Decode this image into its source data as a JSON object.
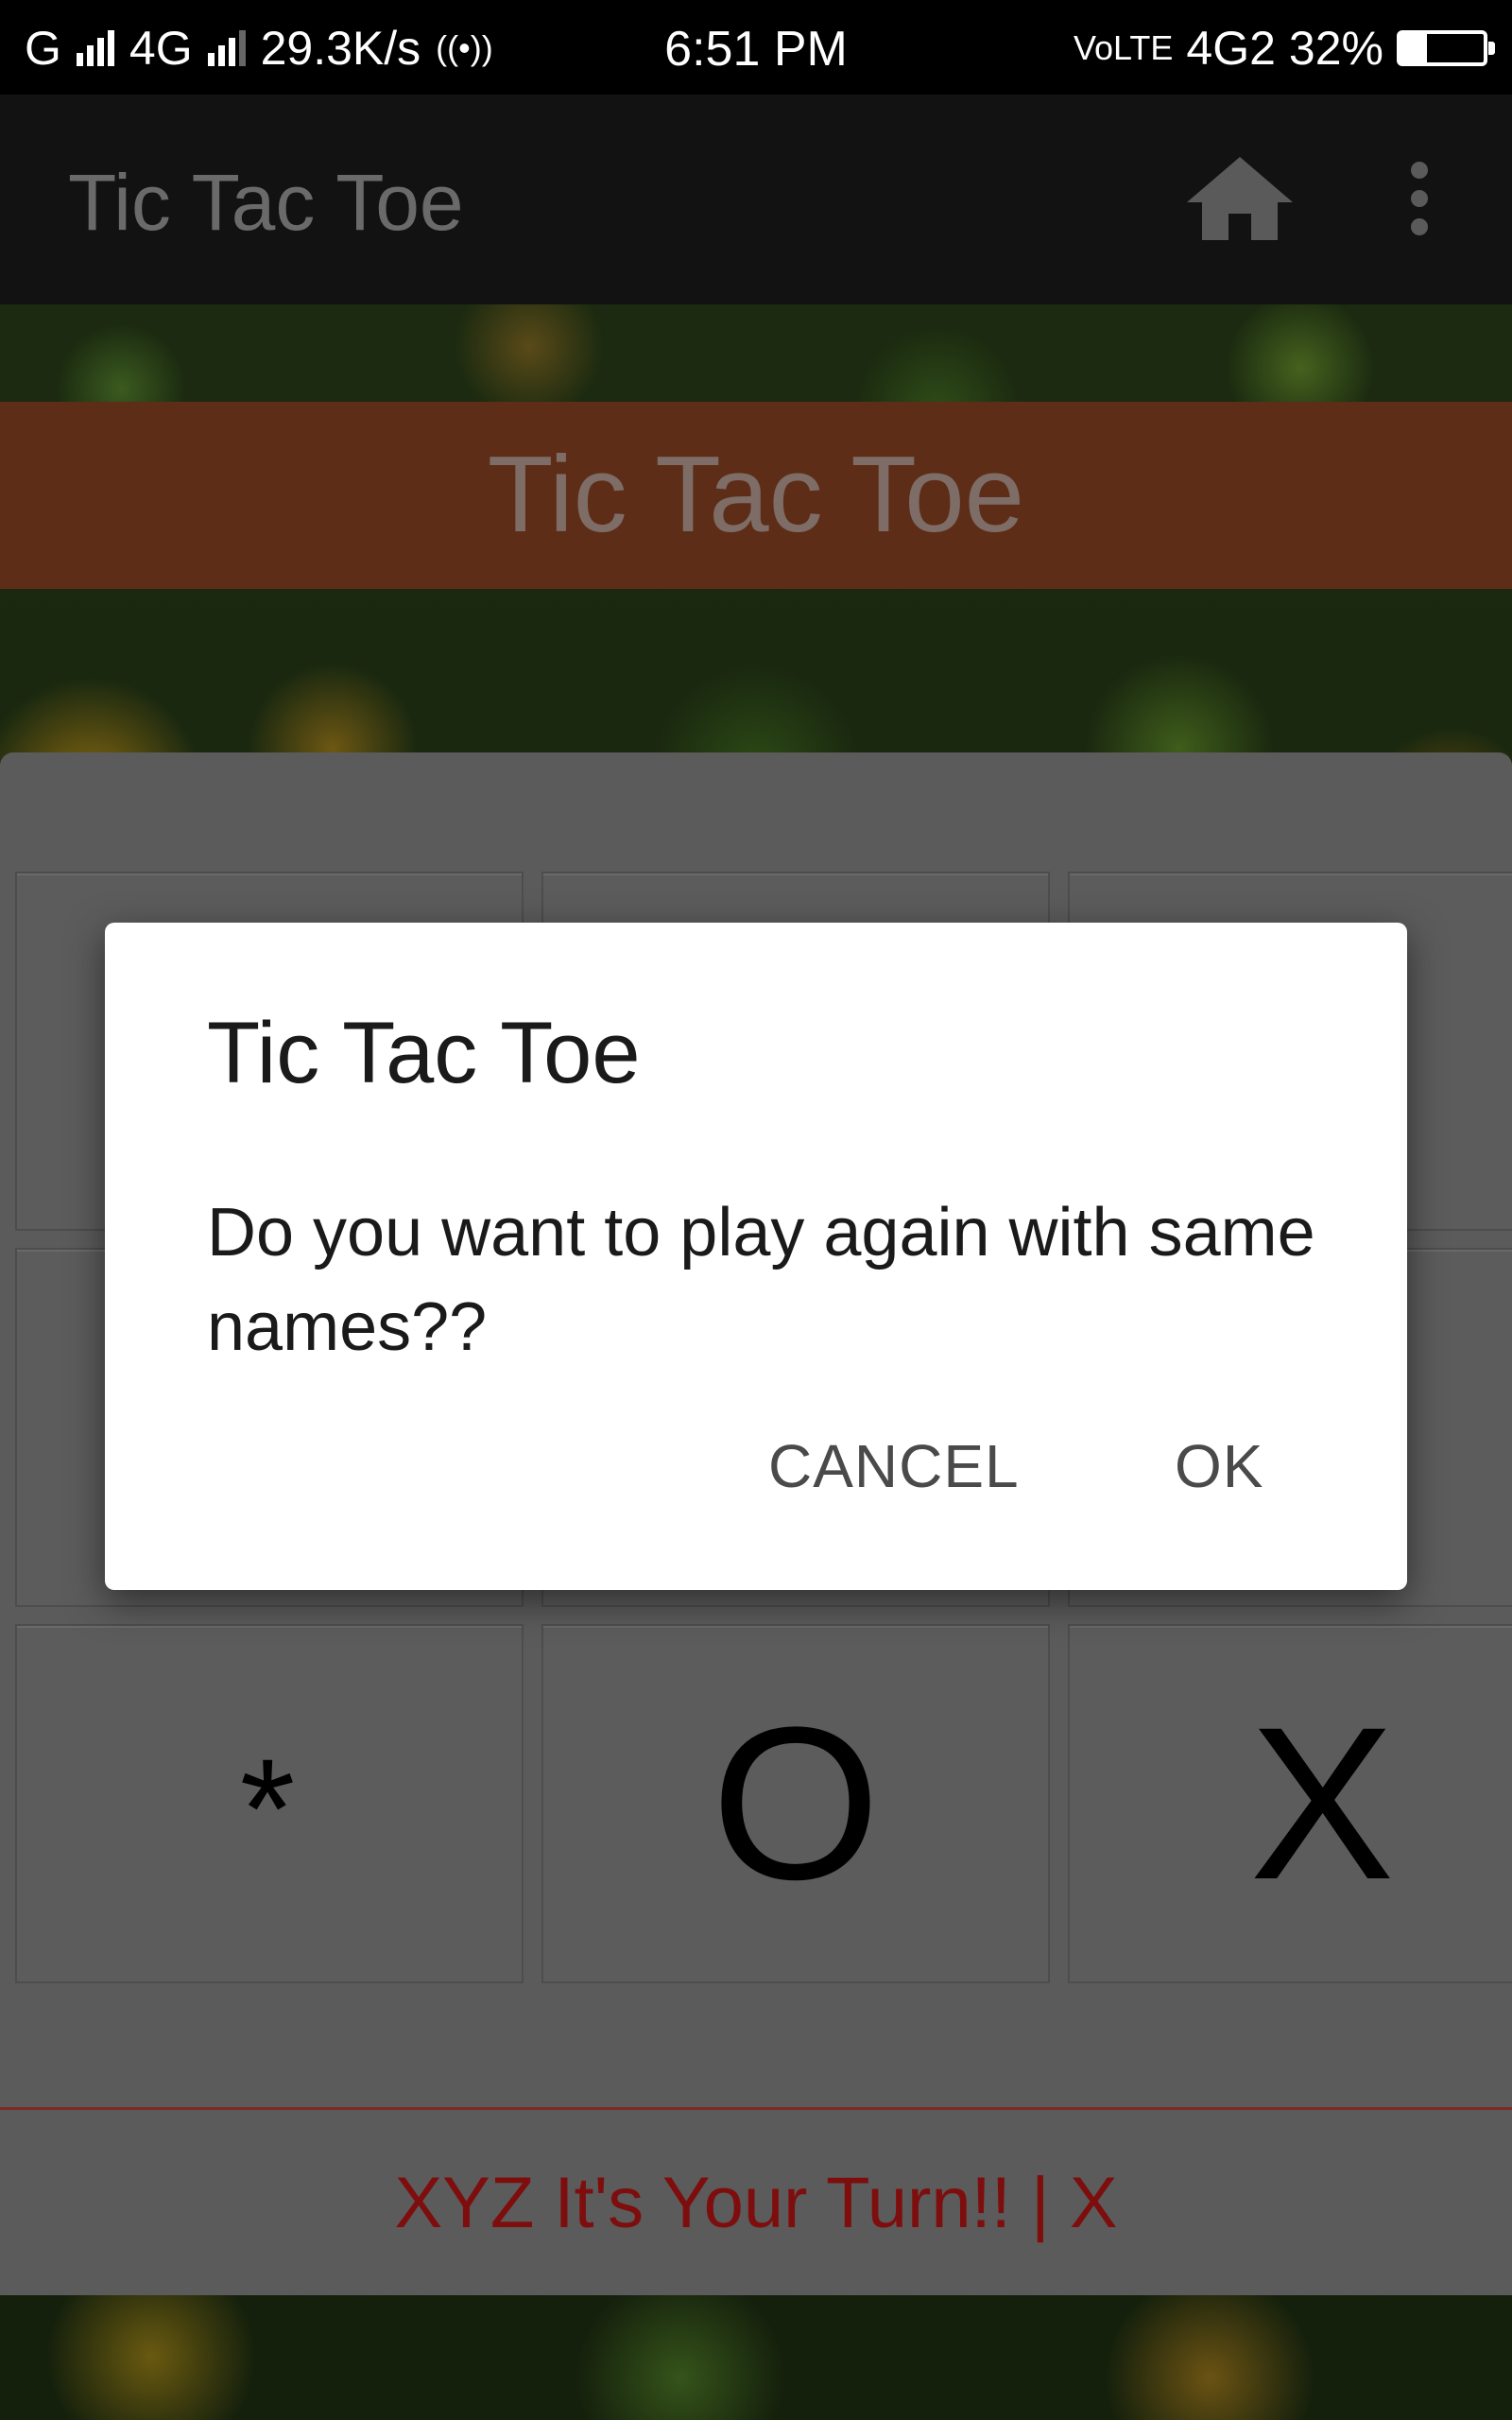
{
  "status_bar": {
    "carrier_1": "G",
    "carrier_2": "4G",
    "net_speed": "29.3K/s",
    "hotspot_glyph": "((•))",
    "time": "6:51 PM",
    "volte": "VoLTE",
    "network": "4G2",
    "battery_percent": "32%",
    "battery_level": 0.32
  },
  "app_bar": {
    "title": "Tic Tac Toe",
    "home_icon": "home-icon",
    "menu_icon": "more-vert-icon"
  },
  "banner": {
    "title": "Tic Tac Toe"
  },
  "board": {
    "bottom_row": [
      "*",
      "O",
      "X"
    ]
  },
  "turn": {
    "text": "XYZ It's Your Turn!! | X"
  },
  "dialog": {
    "title": "Tic Tac Toe",
    "message": "Do you want to play again with same names??",
    "cancel_label": "CANCEL",
    "ok_label": "OK"
  },
  "colors": {
    "banner": "#5e2d17",
    "turn_text": "#7e0e0e",
    "card": "#5b5b5b",
    "app_bar": "#121212"
  }
}
